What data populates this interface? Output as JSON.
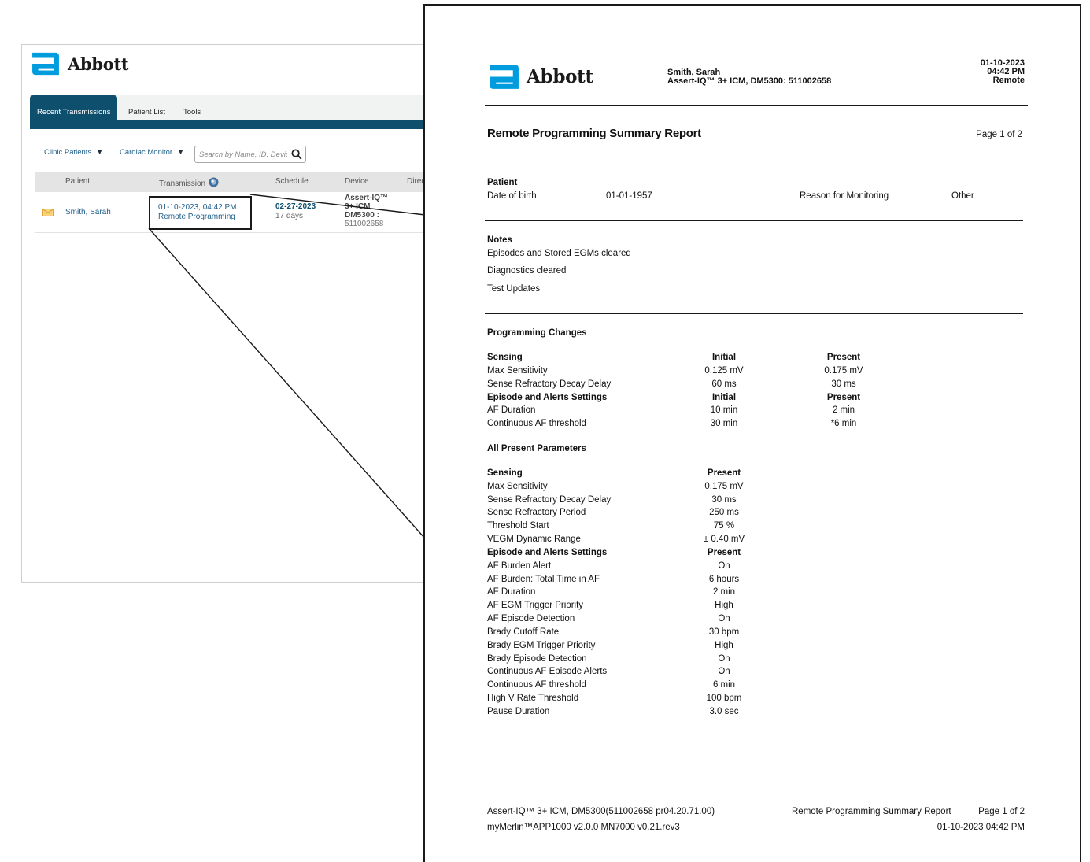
{
  "app": {
    "brand": "Abbott",
    "brand_color": "#009cde",
    "accent_color": "#0f4f6e",
    "tabs": [
      "Recent Transmissions",
      "Patient List",
      "Tools"
    ],
    "filters": [
      {
        "label": "Clinic Patients"
      },
      {
        "label": "Cardiac Monitor"
      }
    ],
    "search": {
      "placeholder": "Search by Name, ID, Device"
    },
    "columns": [
      "Patient",
      "Transmission",
      "Schedule",
      "Device",
      "Direc"
    ],
    "row": {
      "patient": "Smith, Sarah",
      "transmission_date": "01-10-2023, 04:42 PM",
      "transmission_type": "Remote Programming",
      "schedule_date": "02-27-2023",
      "schedule_days": "17 days",
      "device_lines": [
        "Assert-IQ™",
        "3+ ICM",
        "DM5300 :",
        "511002658"
      ]
    }
  },
  "report": {
    "brand": "Abbott",
    "header": {
      "patient_name": "Smith, Sarah",
      "device": "Assert-IQ™ 3+ ICM, DM5300: 511002658",
      "date": "01-10-2023",
      "time": "04:42 PM",
      "mode": "Remote"
    },
    "title": "Remote Programming Summary Report",
    "page": "Page 1 of 2",
    "patient": {
      "heading": "Patient",
      "dob_label": "Date of birth",
      "dob": "01-01-1957",
      "reason_label": "Reason for Monitoring",
      "reason": "Other"
    },
    "notes": {
      "heading": "Notes",
      "items": [
        "Episodes and Stored EGMs cleared",
        "Diagnostics cleared",
        "Test Updates"
      ]
    },
    "programming_changes": {
      "heading": "Programming Changes",
      "rows": [
        {
          "label": "Sensing",
          "initial": "Initial",
          "present": "Present",
          "bold": true
        },
        {
          "label": "Max Sensitivity",
          "initial": "0.125 mV",
          "present": "0.175 mV"
        },
        {
          "label": "Sense Refractory Decay Delay",
          "initial": "60 ms",
          "present": "30 ms"
        },
        {
          "label": "Episode and Alerts Settings",
          "initial": "Initial",
          "present": "Present",
          "bold": true
        },
        {
          "label": "AF Duration",
          "initial": "10 min",
          "present": "2 min"
        },
        {
          "label": "Continuous AF threshold",
          "initial": "30 min",
          "present": "*6 min"
        }
      ]
    },
    "all_present": {
      "heading": "All Present Parameters",
      "rows": [
        {
          "label": "Sensing",
          "value": "Present",
          "bold": true
        },
        {
          "label": "Max Sensitivity",
          "value": "0.175 mV"
        },
        {
          "label": "Sense Refractory Decay Delay",
          "value": "30 ms"
        },
        {
          "label": "Sense Refractory Period",
          "value": "250 ms"
        },
        {
          "label": "Threshold Start",
          "value": "75 %"
        },
        {
          "label": "VEGM Dynamic Range",
          "value": "± 0.40 mV"
        },
        {
          "label": "Episode and Alerts Settings",
          "value": "Present",
          "bold": true
        },
        {
          "label": "AF Burden Alert",
          "value": "On"
        },
        {
          "label": "AF Burden: Total Time in AF",
          "value": "6 hours"
        },
        {
          "label": "AF Duration",
          "value": "2 min"
        },
        {
          "label": "AF EGM Trigger Priority",
          "value": "High"
        },
        {
          "label": "AF Episode Detection",
          "value": "On"
        },
        {
          "label": "Brady Cutoff Rate",
          "value": "30 bpm"
        },
        {
          "label": "Brady EGM Trigger Priority",
          "value": "High"
        },
        {
          "label": "Brady Episode Detection",
          "value": "On"
        },
        {
          "label": "Continuous AF Episode Alerts",
          "value": "On"
        },
        {
          "label": "Continuous AF threshold",
          "value": "6 min"
        },
        {
          "label": "High V Rate Threshold",
          "value": "100 bpm"
        },
        {
          "label": "Pause Duration",
          "value": "3.0 sec"
        }
      ]
    },
    "footer": {
      "device_line": "Assert-IQ™ 3+ ICM, DM5300(511002658 pr04.20.71.00)",
      "app_line": "myMerlin™APP1000 v2.0.0  MN7000  v0.21.rev3",
      "report_name": "Remote Programming Summary Report",
      "page": "Page 1 of 2",
      "datetime": "01-10-2023 04:42 PM"
    }
  }
}
